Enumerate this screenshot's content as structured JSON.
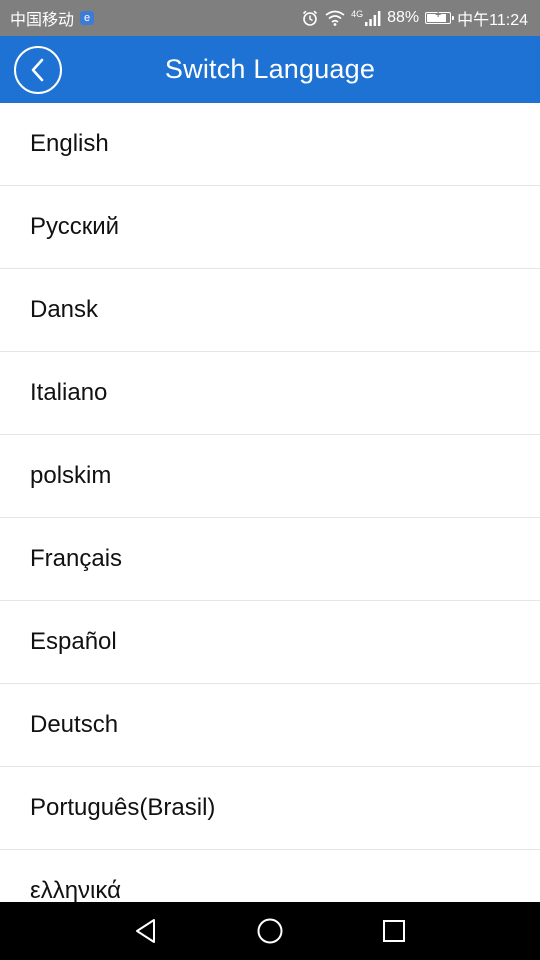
{
  "status_bar": {
    "carrier": "中国移动",
    "carrier_badge": "e",
    "network_type": "4G",
    "battery_percent": "88%",
    "battery_level": 0.88,
    "time": "中午11:24",
    "icons": [
      "alarm-icon",
      "wifi-icon",
      "signal-icon",
      "battery-icon"
    ]
  },
  "header": {
    "title": "Switch Language",
    "back_icon": "chevron-left-icon",
    "background_color": "#1e72d3"
  },
  "languages": [
    {
      "label": "English"
    },
    {
      "label": "Русский"
    },
    {
      "label": "Dansk"
    },
    {
      "label": "Italiano"
    },
    {
      "label": "polskim"
    },
    {
      "label": "Français"
    },
    {
      "label": "Español"
    },
    {
      "label": "Deutsch"
    },
    {
      "label": "Português(Brasil)"
    },
    {
      "label": "ελληνικά"
    }
  ],
  "nav_bar": {
    "icons": [
      "back-triangle-icon",
      "home-circle-icon",
      "recents-square-icon"
    ]
  }
}
